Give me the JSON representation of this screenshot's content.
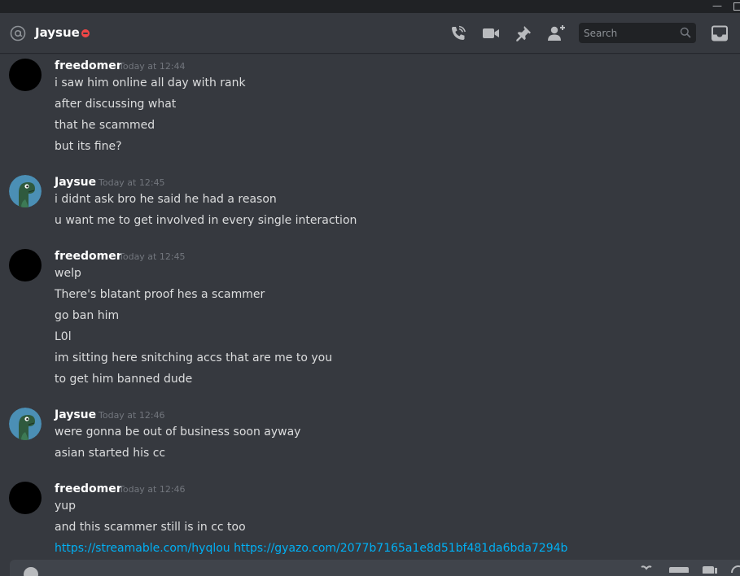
{
  "window": {
    "minimize_glyph": "—"
  },
  "header": {
    "name": "Jaysue",
    "search_placeholder": "Search",
    "icons": [
      "at-icon",
      "call-icon",
      "video-icon",
      "pin-icon",
      "add-friend-icon",
      "search-icon",
      "inbox-icon"
    ]
  },
  "colors": {
    "background": "#36393f",
    "link": "#00b0f4",
    "dnd": "#f04747",
    "timestamp": "#72767d"
  },
  "messages": [
    {
      "author": "freedomer",
      "timestamp": "Today at 12:44",
      "lines": [
        "i saw him online all day with rank",
        "after discussing what",
        "that he scammed",
        "but its fine?"
      ]
    },
    {
      "author": "Jaysue",
      "timestamp": "Today at 12:45",
      "lines": [
        "i didnt ask bro he said he had a reason",
        "u want me to get involved in every single interaction"
      ]
    },
    {
      "author": "freedomer",
      "timestamp": "Today at 12:45",
      "lines": [
        "welp",
        "There's blatant proof hes a scammer",
        "go ban him",
        "L0l",
        "im sitting here snitching accs that are me to you",
        "to get him banned dude"
      ]
    },
    {
      "author": "Jaysue",
      "timestamp": "Today at 12:46",
      "lines": [
        "were gonna be out of business soon ayway",
        "asian started his cc"
      ]
    },
    {
      "author": "freedomer",
      "timestamp": "Today at 12:46",
      "lines": [
        "yup",
        "and this scammer still is in cc too"
      ],
      "links": [
        "https://streamable.com/hyqlou",
        "https://gyazo.com/2077b7165a1e8d51bf481da6bda7294b"
      ]
    }
  ]
}
